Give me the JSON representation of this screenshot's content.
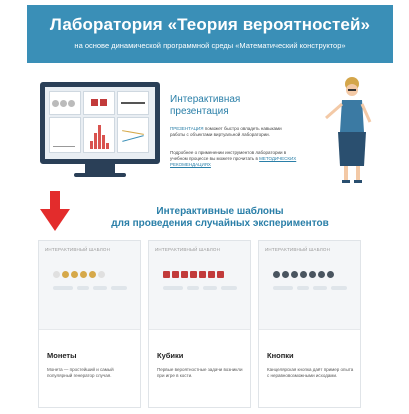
{
  "header": {
    "title": "Лаборатория «Теория вероятностей»",
    "subtitle": "на основе динамической программной среды «Математический конструктор»"
  },
  "presentation": {
    "title_line1": "Интерактивная",
    "title_line2": "презентация",
    "desc_highlight": "ПРЕЗЕНТАЦИЯ",
    "desc_rest": " поможет быстро овладеть навыками работы с объектами виртуальной лаборатории.",
    "desc2_text": "Подробнее о применении инструментов лаборатории в учебном процессе вы можете прочитать в ",
    "desc2_link": "МЕТОДИЧЕСКИХ РЕКОМЕНДАЦИЯХ"
  },
  "section": {
    "title_line1": "Интерактивные шаблоны",
    "title_line2": "для проведения случайных экспериментов"
  },
  "cards": [
    {
      "label": "ИНТЕРАКТИВНЫЙ ШАБЛОН",
      "name": "Монеты",
      "desc": "Монета — простейший и самый популярный генератор случая."
    },
    {
      "label": "ИНТЕРАКТИВНЫЙ ШАБЛОН",
      "name": "Кубики",
      "desc": "Первые вероятностные задачи возникли при игре в кости."
    },
    {
      "label": "ИНТЕРАКТИВНЫЙ ШАБЛОН",
      "name": "Кнопки",
      "desc": "Канцелярская кнопка даёт пример опыта с неравновозможными исходами."
    }
  ],
  "colors": {
    "header_bg": "#3a8fb7",
    "accent": "#2a7fa8",
    "arrow": "#e32c2c",
    "coin": "#d6a94a",
    "die": "#c23b3b",
    "pin": "#4a5560"
  }
}
